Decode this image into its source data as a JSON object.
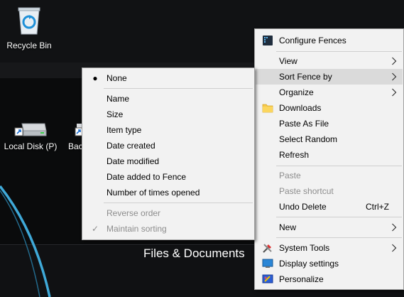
{
  "desktop": {
    "icons": [
      {
        "label": "Recycle Bin",
        "icon": "recycle-bin-icon"
      },
      {
        "label": "Local Disk (P)",
        "icon": "drive-icon"
      },
      {
        "label": "Backup",
        "icon": "drive-icon"
      }
    ],
    "fence_title": "Files & Documents",
    "accent_color": "#3fa9d8"
  },
  "context_menu": {
    "items": [
      {
        "label": "Configure Fences",
        "icon": "fences-icon"
      },
      {
        "label": "View",
        "submenu": true
      },
      {
        "label": "Sort Fence by",
        "submenu": true,
        "highlighted": true
      },
      {
        "label": "Organize",
        "submenu": true
      },
      {
        "label": "Downloads",
        "icon": "folder-icon"
      },
      {
        "label": "Paste As File"
      },
      {
        "label": "Select Random"
      },
      {
        "label": "Refresh"
      },
      {
        "label": "Paste",
        "disabled": true
      },
      {
        "label": "Paste shortcut",
        "disabled": true
      },
      {
        "label": "Undo Delete",
        "shortcut": "Ctrl+Z"
      },
      {
        "label": "New",
        "submenu": true
      },
      {
        "label": "System Tools",
        "icon": "tools-icon",
        "submenu": true
      },
      {
        "label": "Display settings",
        "icon": "display-icon"
      },
      {
        "label": "Personalize",
        "icon": "personalize-icon"
      }
    ]
  },
  "sort_submenu": {
    "items": [
      {
        "label": "None",
        "selected": true,
        "mark": "●"
      },
      {
        "label": "Name"
      },
      {
        "label": "Size"
      },
      {
        "label": "Item type"
      },
      {
        "label": "Date created"
      },
      {
        "label": "Date modified"
      },
      {
        "label": "Date added to Fence"
      },
      {
        "label": "Number of times opened"
      },
      {
        "label": "Reverse order",
        "disabled": true
      },
      {
        "label": "Maintain sorting",
        "disabled": true,
        "checked": true,
        "mark": "✓"
      }
    ]
  }
}
